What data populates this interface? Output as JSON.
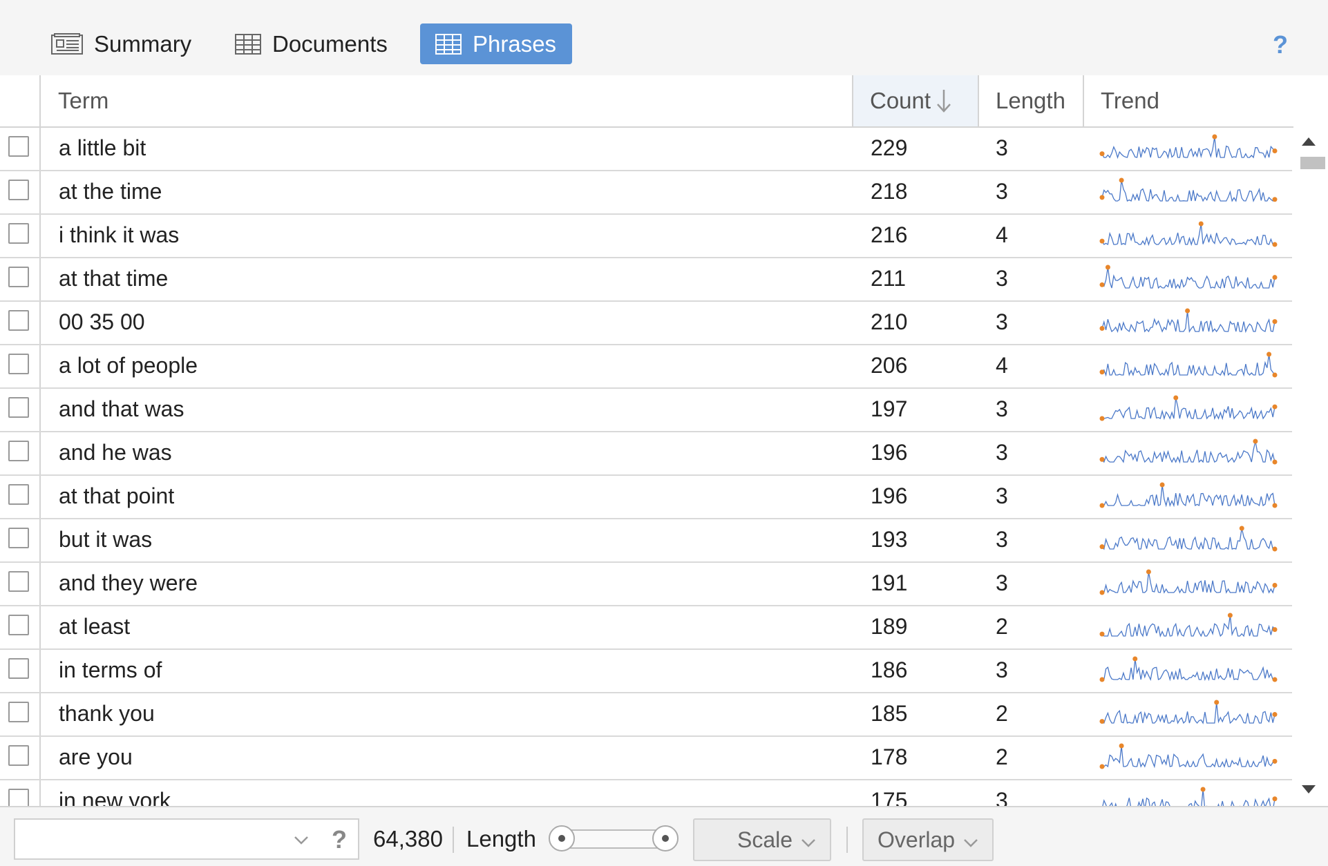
{
  "tabs": [
    {
      "label": "Summary",
      "icon": "summary-icon",
      "active": false
    },
    {
      "label": "Documents",
      "icon": "table-icon",
      "active": false
    },
    {
      "label": "Phrases",
      "icon": "table-icon",
      "active": true
    }
  ],
  "help_label": "?",
  "columns": {
    "term": "Term",
    "count": "Count",
    "length": "Length",
    "trend": "Trend"
  },
  "sort": {
    "column": "count",
    "direction": "descending"
  },
  "rows": [
    {
      "term": "a little bit",
      "count": "229",
      "length": "3"
    },
    {
      "term": "at the time",
      "count": "218",
      "length": "3"
    },
    {
      "term": "i think it was",
      "count": "216",
      "length": "4"
    },
    {
      "term": "at that time",
      "count": "211",
      "length": "3"
    },
    {
      "term": "00 35 00",
      "count": "210",
      "length": "3"
    },
    {
      "term": "a lot of people",
      "count": "206",
      "length": "4"
    },
    {
      "term": "and that was",
      "count": "197",
      "length": "3"
    },
    {
      "term": "and he was",
      "count": "196",
      "length": "3"
    },
    {
      "term": "at that point",
      "count": "196",
      "length": "3"
    },
    {
      "term": "but it was",
      "count": "193",
      "length": "3"
    },
    {
      "term": "and they were",
      "count": "191",
      "length": "3"
    },
    {
      "term": "at least",
      "count": "189",
      "length": "2"
    },
    {
      "term": "in terms of",
      "count": "186",
      "length": "3"
    },
    {
      "term": "thank you",
      "count": "185",
      "length": "2"
    },
    {
      "term": "are you",
      "count": "178",
      "length": "2"
    },
    {
      "term": "in new york",
      "count": "175",
      "length": "3"
    }
  ],
  "footer": {
    "search_value": "",
    "help_label": "?",
    "total": "64,380",
    "length_label": "Length",
    "scale_label": "Scale",
    "overlap_label": "Overlap"
  },
  "colors": {
    "accent": "#5b93d6",
    "spark_line": "#4a78c8",
    "spark_marker": "#e8862a"
  }
}
